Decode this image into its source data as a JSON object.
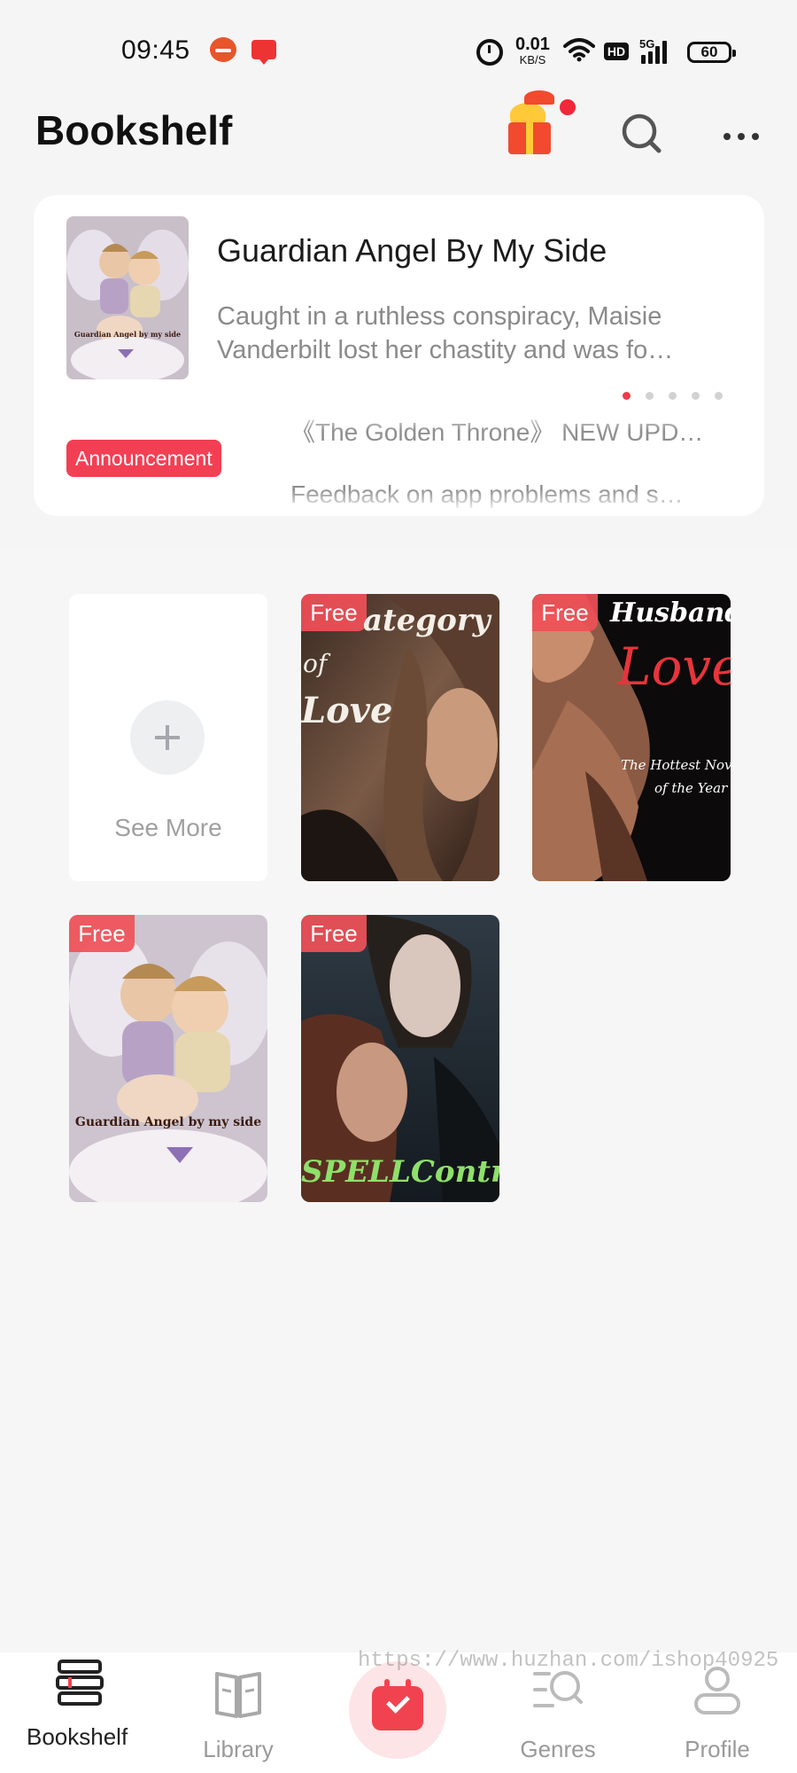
{
  "status_bar": {
    "time": "09:45",
    "net_speed_value": "0.01",
    "net_speed_unit": "KB/S",
    "hd_label": "HD",
    "network_label": "5G",
    "battery": "60"
  },
  "header": {
    "title": "Bookshelf",
    "icons": [
      "gift-icon",
      "search-icon",
      "more-icon"
    ]
  },
  "featured": {
    "title": "Guardian Angel By My Side",
    "description": "Caught in a ruthless conspiracy, Maisie Vanderbilt lost her chastity and was fo…",
    "cover_text": "Guardian Angel by my side",
    "carousel_page_count": 5,
    "carousel_active_index": 0
  },
  "announcement": {
    "label": "Announcement",
    "items": [
      "《The Golden Throne》 NEW UPD…",
      "Feedback on app problems and s…"
    ]
  },
  "shelf": {
    "see_more_label": "See More",
    "badge_label": "Free",
    "books": [
      {
        "cover_text": [
          "ategory",
          "of",
          "Love"
        ]
      },
      {
        "cover_text": [
          "Husband's",
          "Love",
          "The Hottest Novel",
          "of the Year"
        ]
      },
      {
        "cover_text": [
          "Guardian Angel by my side"
        ]
      },
      {
        "cover_text": [
          "SPELLContract"
        ]
      }
    ]
  },
  "watermark": "https://www.huzhan.com/ishop40925",
  "nav": {
    "items": [
      {
        "label": "Bookshelf",
        "icon": "bookshelf-icon",
        "active": true
      },
      {
        "label": "Library",
        "icon": "library-icon",
        "active": false
      },
      {
        "label": "",
        "icon": "check-in-calendar-icon",
        "active": false
      },
      {
        "label": "Genres",
        "icon": "genres-icon",
        "active": false
      },
      {
        "label": "Profile",
        "icon": "profile-icon",
        "active": false
      }
    ]
  },
  "colors": {
    "accent": "#f33f53",
    "background": "#f6f6f6",
    "card": "#ffffff",
    "text_primary": "#1b1b1b",
    "text_secondary": "#8a8a8a"
  }
}
